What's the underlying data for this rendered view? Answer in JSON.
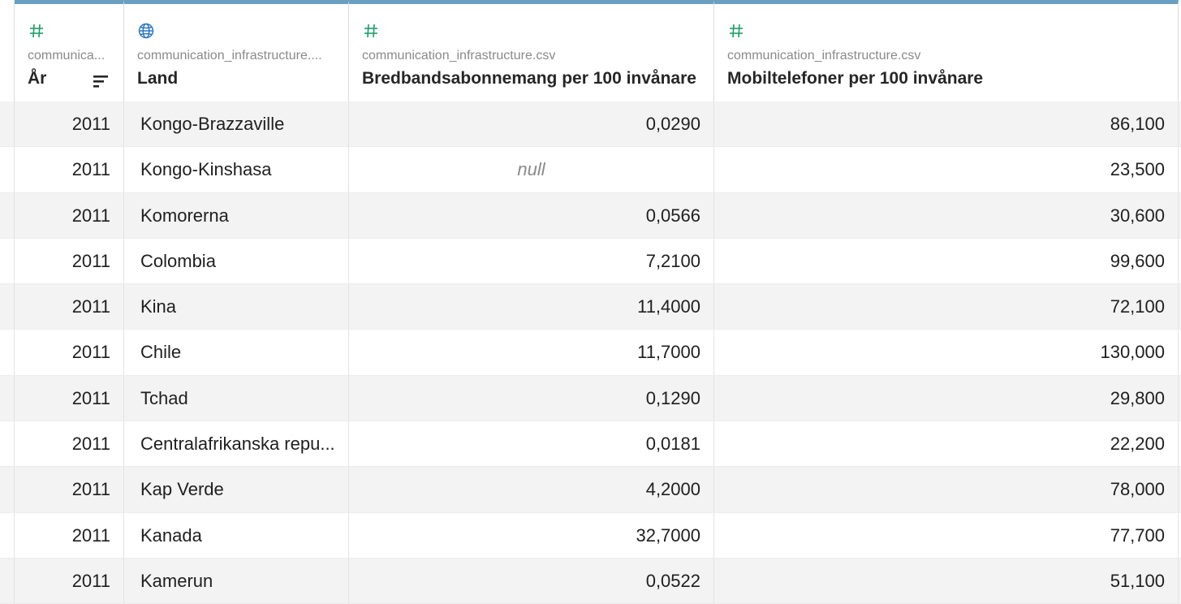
{
  "columns": [
    {
      "icon": "hash-icon",
      "source": "communica...",
      "title": "År"
    },
    {
      "icon": "globe-icon",
      "source": "communication_infrastructure....",
      "title": "Land"
    },
    {
      "icon": "hash-icon",
      "source": "communication_infrastructure.csv",
      "title": "Bredbandsabonnemang per 100 invånare"
    },
    {
      "icon": "hash-icon",
      "source": "communication_infrastructure.csv",
      "title": "Mobiltelefoner per 100 invånare"
    }
  ],
  "rows": [
    {
      "year": "2011",
      "country": "Kongo-Brazzaville",
      "broadband": "0,0290",
      "mobile": "86,100"
    },
    {
      "year": "2011",
      "country": "Kongo-Kinshasa",
      "broadband": "null",
      "mobile": "23,500"
    },
    {
      "year": "2011",
      "country": "Komorerna",
      "broadband": "0,0566",
      "mobile": "30,600"
    },
    {
      "year": "2011",
      "country": "Colombia",
      "broadband": "7,2100",
      "mobile": "99,600"
    },
    {
      "year": "2011",
      "country": "Kina",
      "broadband": "11,4000",
      "mobile": "72,100"
    },
    {
      "year": "2011",
      "country": "Chile",
      "broadband": "11,7000",
      "mobile": "130,000"
    },
    {
      "year": "2011",
      "country": "Tchad",
      "broadband": "0,1290",
      "mobile": "29,800"
    },
    {
      "year": "2011",
      "country": "Centralafrikanska repu...",
      "broadband": "0,0181",
      "mobile": "22,200"
    },
    {
      "year": "2011",
      "country": "Kap Verde",
      "broadband": "4,2000",
      "mobile": "78,000"
    },
    {
      "year": "2011",
      "country": "Kanada",
      "broadband": "32,7000",
      "mobile": "77,700"
    },
    {
      "year": "2011",
      "country": "Kamerun",
      "broadband": "0,0522",
      "mobile": "51,100"
    }
  ],
  "colors": {
    "accent": "#6a9fc2",
    "hash_icon": "#1e9e6a",
    "globe_icon": "#2b78c2",
    "null_text": "#8a8a8a"
  }
}
